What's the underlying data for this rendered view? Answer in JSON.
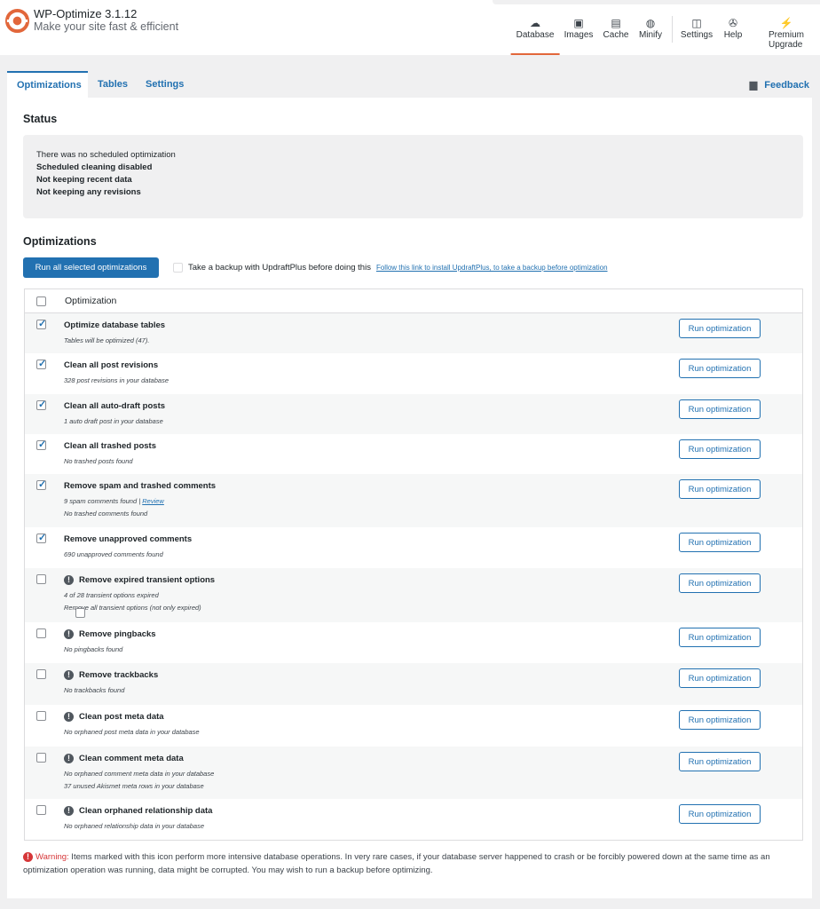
{
  "header": {
    "title": "WP-Optimize 3.1.12",
    "tagline": "Make your site fast & efficient",
    "nav": [
      {
        "label": "Database",
        "icon": "cloud-icon",
        "glyph": "☁"
      },
      {
        "label": "Images",
        "icon": "images-icon",
        "glyph": "▣"
      },
      {
        "label": "Cache",
        "icon": "archive-icon",
        "glyph": "▤"
      },
      {
        "label": "Minify",
        "icon": "dashboard-icon",
        "glyph": "◍"
      },
      {
        "label": "Settings",
        "icon": "settings-icon",
        "glyph": "◫"
      },
      {
        "label": "Help",
        "icon": "lifebuoy-icon",
        "glyph": "✇"
      },
      {
        "label": "Premium Upgrade",
        "icon": "plugin-icon",
        "glyph": "⚡"
      }
    ],
    "accent": "#e2673b"
  },
  "tabs": [
    "Optimizations",
    "Tables",
    "Settings"
  ],
  "feedback": "Feedback",
  "status": {
    "heading": "Status",
    "lines": [
      "There was no scheduled optimization",
      "Scheduled cleaning disabled",
      "Not keeping recent data",
      "Not keeping any revisions"
    ]
  },
  "optimizations": {
    "heading": "Optimizations",
    "run_all": "Run all selected optimizations",
    "backup_label": "Take a backup with UpdraftPlus before doing this",
    "backup_link": "Follow this link to install UpdraftPlus, to take a backup before optimization",
    "column": "Optimization",
    "run_label": "Run optimization",
    "rows": [
      {
        "name": "Optimize database tables",
        "checked": true,
        "warn": false,
        "sub": [
          "Tables will be optimized (47)."
        ]
      },
      {
        "name": "Clean all post revisions",
        "checked": true,
        "warn": false,
        "sub": [
          "328 post revisions in your database"
        ]
      },
      {
        "name": "Clean all auto-draft posts",
        "checked": true,
        "warn": false,
        "sub": [
          "1 auto draft post in your database"
        ]
      },
      {
        "name": "Clean all trashed posts",
        "checked": true,
        "warn": false,
        "sub": [
          "No trashed posts found"
        ]
      },
      {
        "name": "Remove spam and trashed comments",
        "checked": true,
        "warn": false,
        "sub": [
          "9 spam comments found | ",
          "No trashed comments found"
        ],
        "link": "Review"
      },
      {
        "name": "Remove unapproved comments",
        "checked": true,
        "warn": false,
        "sub": [
          "690 unapproved comments found"
        ]
      },
      {
        "name": "Remove expired transient options",
        "checked": false,
        "warn": true,
        "sub": [
          "4 of 28 transient options expired"
        ],
        "option": "Remove all transient options (not only expired)"
      },
      {
        "name": "Remove pingbacks",
        "checked": false,
        "warn": true,
        "sub": [
          "No pingbacks found"
        ]
      },
      {
        "name": "Remove trackbacks",
        "checked": false,
        "warn": true,
        "sub": [
          "No trackbacks found"
        ]
      },
      {
        "name": "Clean post meta data",
        "checked": false,
        "warn": true,
        "sub": [
          "No orphaned post meta data in your database"
        ]
      },
      {
        "name": "Clean comment meta data",
        "checked": false,
        "warn": true,
        "sub": [
          "No orphaned comment meta data in your database",
          "37 unused Akismet meta rows in your database"
        ]
      },
      {
        "name": "Clean orphaned relationship data",
        "checked": false,
        "warn": true,
        "sub": [
          "No orphaned relationship data in your database"
        ]
      }
    ]
  },
  "warning": {
    "label": "Warning:",
    "text": " Items marked with this icon perform more intensive database operations. In very rare cases, if your database server happened to crash or be forcibly powered down at the same time as an optimization operation was running, data might be corrupted. You may wish to run a backup before optimizing."
  }
}
